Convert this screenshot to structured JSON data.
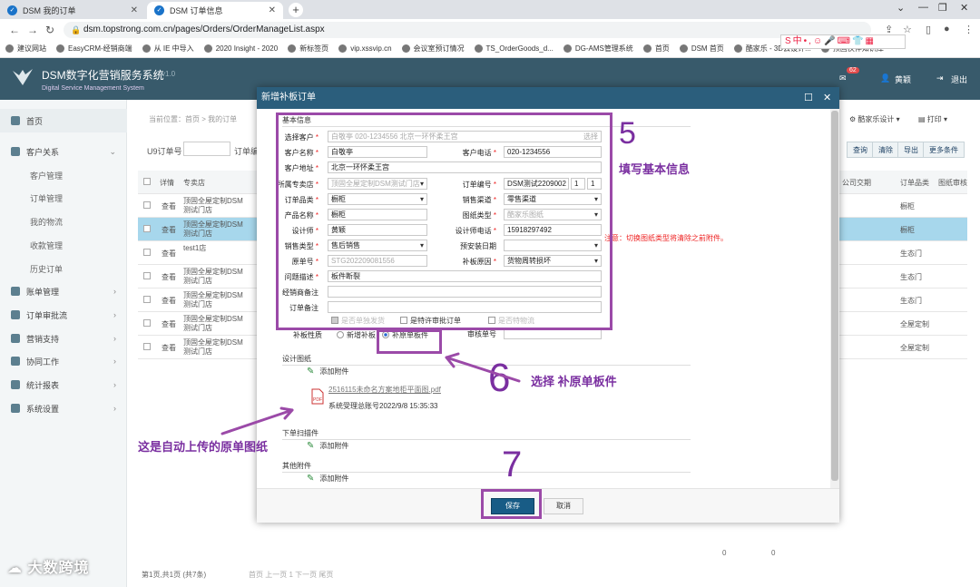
{
  "browser": {
    "tabs": [
      {
        "title": "DSM 我的订单"
      },
      {
        "title": "DSM 订单信息"
      }
    ],
    "url": "dsm.topstrong.com.cn/pages/Orders/OrderManageList.aspx",
    "bookmarks": [
      "建议网站",
      "EasyCRM-经销商端",
      "从 IE 中导入",
      "2020 Insight - 2020",
      "新标签页",
      "vip.xssvip.cn",
      "会议室预订情况",
      "TS_OrderGoods_d...",
      "DG-AMS管理系统",
      "首页",
      "DSM 首页",
      "酷家乐 - 3D云设计...",
      "顶固伙伴知识库"
    ]
  },
  "app": {
    "name": "DSM数字化营销服务系统",
    "subtitle": "Digital Service Management System",
    "version": "v1.0",
    "badge": "62",
    "user": "黄颖",
    "logout": "退出"
  },
  "sidebar": [
    {
      "label": "首页",
      "type": "head"
    },
    {
      "label": "客户关系",
      "type": "head"
    },
    {
      "label": "客户管理",
      "type": "sub"
    },
    {
      "label": "订单管理",
      "type": "sub"
    },
    {
      "label": "我的物流",
      "type": "sub"
    },
    {
      "label": "收款管理",
      "type": "sub"
    },
    {
      "label": "历史订单",
      "type": "sub"
    },
    {
      "label": "账单管理",
      "type": "head"
    },
    {
      "label": "订单审批流",
      "type": "head"
    },
    {
      "label": "营销支持",
      "type": "head"
    },
    {
      "label": "协同工作",
      "type": "head"
    },
    {
      "label": "统计报表",
      "type": "head"
    },
    {
      "label": "系统设置",
      "type": "head"
    }
  ],
  "content": {
    "breadcrumb": "当前位置：首页 > 我的订单",
    "search_label": "U9订单号",
    "search_label2": "订单编",
    "toolbar": {
      "kujiale": "酷家乐设计",
      "print": "打印",
      "query": "查询",
      "clear": "清除",
      "export": "导出",
      "more": "更多条件"
    },
    "columns": {
      "detail": "详情",
      "shop": "专卖店",
      "company": "公司交期",
      "type": "订单品类",
      "review": "图纸审核"
    },
    "rows": [
      {
        "action": "查看",
        "shop": "顶固全屋定制DSM测试门店",
        "type": "橱柜"
      },
      {
        "action": "查看",
        "shop": "顶固全屋定制DSM测试门店",
        "type": "橱柜"
      },
      {
        "action": "查看",
        "shop": "test1店",
        "type": "生态门"
      },
      {
        "action": "查看",
        "shop": "顶固全屋定制DSM测试门店",
        "type": "生态门"
      },
      {
        "action": "查看",
        "shop": "顶固全屋定制DSM测试门店",
        "type": "生态门"
      },
      {
        "action": "查看",
        "shop": "顶固全屋定制DSM测试门店",
        "type": "全屋定制"
      },
      {
        "action": "查看",
        "shop": "顶固全屋定制DSM测试门店",
        "type": "全屋定制"
      }
    ],
    "totals": [
      "0",
      "0"
    ],
    "pager": "第1页,共1页 (共7条)",
    "pager_links": "首页 上一页 1 下一页 尾页"
  },
  "dialog": {
    "title": "新增补板订单",
    "section_basic": "基本信息",
    "fields": {
      "select_customer": {
        "label": "选择客户",
        "value": "白敬亭 020-1234556 北京一环怀柔王宫",
        "btn": "选择"
      },
      "customer_name": {
        "label": "客户名称",
        "value": "白敬亭"
      },
      "customer_phone": {
        "label": "客户电话",
        "value": "020-1234556"
      },
      "customer_address": {
        "label": "客户地址",
        "value": "北京一环怀柔王宫"
      },
      "store": {
        "label": "所属专卖店",
        "value": "顶固全屋定制DSM测试门店"
      },
      "order_no": {
        "label": "订单编号",
        "value": "DSM测试2209002",
        "n1": "1",
        "n2": "1"
      },
      "order_type": {
        "label": "订单品类",
        "value": "橱柜"
      },
      "channel": {
        "label": "销售渠道",
        "value": "零售渠道"
      },
      "product": {
        "label": "产品名称",
        "value": "橱柜"
      },
      "drawing_type": {
        "label": "图纸类型",
        "value": "酷家乐图纸"
      },
      "designer": {
        "label": "设计师",
        "value": "黄颖"
      },
      "designer_phone": {
        "label": "设计师电话",
        "value": "15918297492"
      },
      "sale_type": {
        "label": "销售类型",
        "value": "售后销售"
      },
      "install_date": {
        "label": "预安装日期",
        "value": ""
      },
      "orig_no": {
        "label": "原单号",
        "value": "STG202209081556"
      },
      "reason": {
        "label": "补板原因",
        "value": "货物周转损坏"
      },
      "problem": {
        "label": "问题描述",
        "value": "板件断裂"
      },
      "dealer_note": {
        "label": "经销商备注",
        "value": ""
      },
      "order_note": {
        "label": "订单备注",
        "value": ""
      }
    },
    "tip": "注意：切换图纸类型将清除之前附件。",
    "checks": {
      "c1": "是否单独发货",
      "c2": "是特许审批订单",
      "c3": "是否特物流"
    },
    "nature": {
      "label": "补板性质",
      "opt1": "新增补板",
      "opt2": "补原单板件"
    },
    "review_no": {
      "label": "审核单号",
      "value": ""
    },
    "section_drawing": "设计图纸",
    "add_attachment": "添加附件",
    "file_name": "2516115未命名方案地柜平面图.pdf",
    "file_meta": "系统受理总账号2022/9/8 15:35:33",
    "section_scan": "下单扫描件",
    "section_other": "其他附件",
    "save": "保存",
    "cancel": "取消"
  },
  "annotations": {
    "n5": "5",
    "t5": "填写基本信息",
    "n6": "6",
    "t6": "选择 补原单板件",
    "n7": "7",
    "left_note": "这是自动上传的原单图纸"
  },
  "watermark": "大数跨境",
  "colors": {
    "header": "#385a6b",
    "dialog_title": "#2b5e7c",
    "annotation": "#9b4aa8",
    "save": "#185c86",
    "selected_row": "#a7d7ec"
  }
}
